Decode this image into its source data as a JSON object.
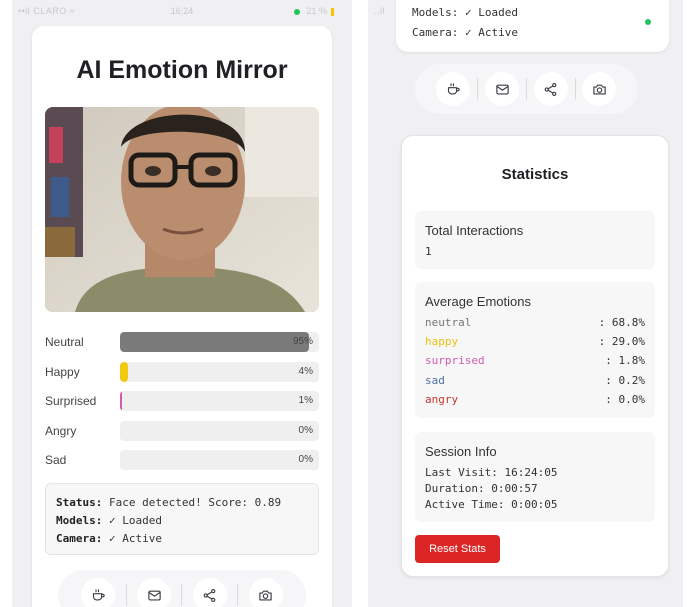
{
  "status_bar": {
    "carrier": "••ll CLARO ≈",
    "time": "16:24",
    "battery": "21 %"
  },
  "app": {
    "title": "AI Emotion Mirror"
  },
  "emotions": [
    {
      "label": "Neutral",
      "pct_text": "95%",
      "value": 0.95,
      "color": "#7a7a7a"
    },
    {
      "label": "Happy",
      "pct_text": "4%",
      "value": 0.04,
      "color": "#f2c811"
    },
    {
      "label": "Surprised",
      "pct_text": "1%",
      "value": 0.01,
      "color": "#d45ab0"
    },
    {
      "label": "Angry",
      "pct_text": "0%",
      "value": 0.0,
      "color": "#c0392b"
    },
    {
      "label": "Sad",
      "pct_text": "0%",
      "value": 0.0,
      "color": "#4a6fa5"
    }
  ],
  "status": {
    "status_label": "Status:",
    "status_value": " Face detected! Score: 0.89",
    "models_label": "Models:",
    "models_value": " ✓ Loaded",
    "camera_label": "Camera:",
    "camera_value": " ✓ Active",
    "models_partial": "Models: ✓ Loaded"
  },
  "actions": [
    {
      "name": "coffee",
      "icon": "coffee-icon"
    },
    {
      "name": "mail",
      "icon": "mail-icon"
    },
    {
      "name": "share",
      "icon": "share-icon"
    },
    {
      "name": "camera",
      "icon": "camera-icon"
    }
  ],
  "stats": {
    "title": "Statistics",
    "total_label": "Total Interactions",
    "total_value": "1",
    "avg_label": "Average Emotions",
    "averages": [
      {
        "name": "neutral",
        "value": ": 68.8%",
        "color": "#777777"
      },
      {
        "name": "happy",
        "value": ": 29.0%",
        "color": "#e8c20e"
      },
      {
        "name": "surprised",
        "value": ": 1.8%",
        "color": "#d45ab0"
      },
      {
        "name": "sad",
        "value": ": 0.2%",
        "color": "#4a6fa5"
      },
      {
        "name": "angry",
        "value": ": 0.0%",
        "color": "#c0392b"
      }
    ],
    "session_label": "Session Info",
    "last_visit": "Last Visit: 16:24:05",
    "duration": "Duration: 0:00:57",
    "active_time": "Active Time: 0:00:05",
    "reset_label": "Reset Stats"
  }
}
